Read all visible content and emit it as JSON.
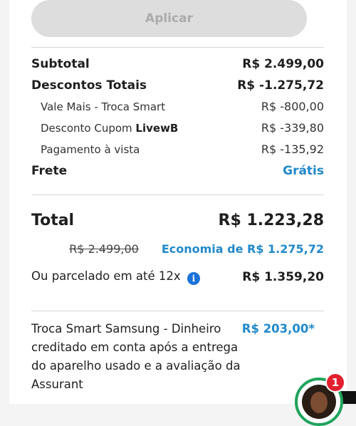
{
  "coupon": {
    "apply_label": "Aplicar"
  },
  "summary": {
    "subtotal_label": "Subtotal",
    "subtotal_value": "R$ 2.499,00",
    "discounts_label": "Descontos Totais",
    "discounts_value": "R$ -1.275,72",
    "items": [
      {
        "label": "Vale Mais - Troca Smart",
        "value": "R$ -800,00"
      },
      {
        "label_prefix": "Desconto Cupom ",
        "label_code": "LivewB",
        "value": "R$ -339,80"
      },
      {
        "label": "Pagamento à vista",
        "value": "R$ -135,92"
      }
    ],
    "shipping_label": "Frete",
    "shipping_value": "Grátis"
  },
  "total": {
    "label": "Total",
    "value": "R$ 1.223,28",
    "original_price": "R$ 2.499,00",
    "savings": "Economia de R$ 1.275,72",
    "installments_label": "Ou parcelado em até 12x",
    "installments_info_icon": "i",
    "installments_value": "R$ 1.359,20"
  },
  "trade_in": {
    "text": "Troca Smart Samsung - Dinheiro creditado em conta após a entrega do aparelho usado e a avaliação da Assurant",
    "value": "R$ 203,00*"
  },
  "chat": {
    "badge_count": "1"
  },
  "colors": {
    "accent": "#2189ca",
    "badge": "#e3202f",
    "avatar_ring": "#1fa35b"
  },
  "icons": {
    "info": "info-icon",
    "chat": "chat-avatar-icon"
  }
}
